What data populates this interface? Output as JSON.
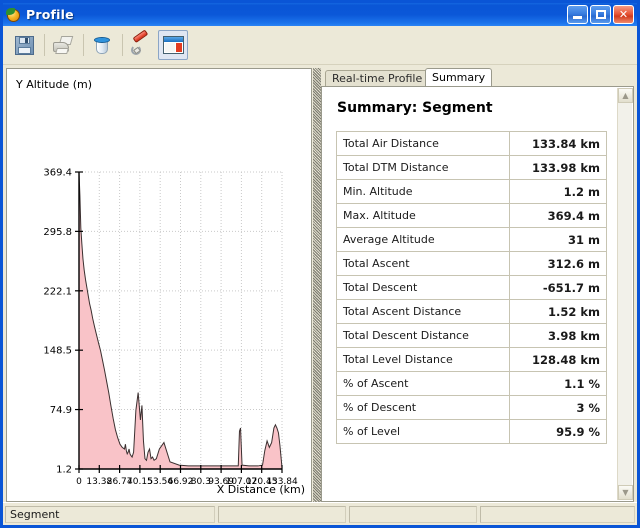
{
  "window": {
    "title": "Profile",
    "icon": "globe-icon",
    "buttons": {
      "minimize": "minimize-button",
      "maximize": "maximize-button",
      "close": "close-button"
    }
  },
  "toolbar": {
    "items": [
      {
        "name": "save-icon",
        "label": "Save",
        "enabled": true,
        "selected": false
      },
      {
        "name": "print-icon",
        "label": "Print",
        "enabled": false,
        "selected": false
      },
      {
        "name": "paint-bucket-icon",
        "label": "Fill Color",
        "enabled": true,
        "selected": false
      },
      {
        "name": "tools-icon",
        "label": "Tools",
        "enabled": true,
        "selected": false
      },
      {
        "name": "window-layout-icon",
        "label": "Show Summary Panel",
        "enabled": true,
        "selected": true
      }
    ]
  },
  "chart_panel": {
    "y_axis_title": "Y Altitude (m)",
    "x_axis_title": "X Distance (km)"
  },
  "chart_data": {
    "type": "area",
    "title": "",
    "xlabel": "X Distance (km)",
    "ylabel": "Y Altitude (m)",
    "xlim": [
      0,
      133.84
    ],
    "ylim": [
      1.2,
      369.4
    ],
    "grid": true,
    "legend": "none",
    "series_color": "#f9c3c8",
    "line_color": "#3a2f2f",
    "xticks": [
      0,
      13.38,
      26.77,
      40.15,
      53.54,
      66.92,
      80.3,
      93.69,
      107.07,
      120.45,
      133.84
    ],
    "yticks": [
      1.2,
      74.9,
      148.5,
      222.1,
      295.8,
      369.4
    ],
    "x": [
      0.0,
      0.6,
      1.2,
      1.9,
      2.6,
      3.4,
      4.3,
      5.2,
      6.1,
      7.0,
      8.0,
      9.0,
      10.2,
      11.5,
      12.8,
      14.2,
      15.5,
      16.8,
      18.2,
      19.6,
      21.0,
      22.5,
      24.0,
      25.5,
      27.0,
      28.5,
      30.0,
      30.6,
      31.2,
      31.8,
      32.4,
      33.0,
      33.6,
      34.2,
      35.0,
      36.0,
      37.5,
      39.0,
      40.5,
      41.5,
      42.5,
      43.5,
      44.5,
      45.5,
      46.5,
      47.5,
      48.5,
      49.5,
      51.0,
      53.0,
      56.0,
      60.0,
      66.0,
      72.0,
      78.0,
      84.0,
      90.0,
      96.0,
      102.0,
      105.0,
      105.8,
      106.5,
      107.5,
      112.0,
      118.0,
      121.0,
      122.5,
      124.0,
      125.5,
      127.0,
      128.5,
      129.5,
      130.5,
      131.5,
      132.5,
      133.84
    ],
    "y": [
      369.4,
      340.0,
      300.0,
      280.0,
      262.0,
      248.0,
      236.0,
      226.0,
      216.0,
      206.0,
      198.0,
      188.0,
      178.0,
      168.0,
      158.0,
      148.0,
      136.0,
      124.0,
      110.0,
      96.0,
      80.0,
      64.0,
      50.0,
      40.0,
      32.0,
      28.0,
      26.0,
      32.0,
      24.0,
      20.0,
      22.0,
      26.0,
      20.0,
      18.0,
      16.0,
      22.0,
      74.0,
      96.0,
      62.0,
      80.0,
      36.0,
      14.0,
      12.0,
      22.0,
      26.0,
      14.0,
      16.0,
      12.0,
      14.0,
      26.0,
      34.0,
      10.0,
      6.0,
      5.0,
      5.0,
      5.0,
      5.0,
      5.0,
      5.0,
      5.0,
      48.0,
      52.0,
      6.0,
      5.0,
      5.0,
      6.0,
      24.0,
      36.0,
      28.0,
      34.0,
      52.0,
      56.0,
      52.0,
      46.0,
      30.0,
      3.0
    ]
  },
  "summary_panel": {
    "tabs": [
      {
        "label": "Real-time Profile",
        "active": false
      },
      {
        "label": "Summary",
        "active": true
      }
    ],
    "heading": "Summary: Segment",
    "rows": [
      {
        "key": "Total Air Distance",
        "value": "133.84 km"
      },
      {
        "key": "Total DTM Distance",
        "value": "133.98 km"
      },
      {
        "key": "Min. Altitude",
        "value": "1.2 m"
      },
      {
        "key": "Max. Altitude",
        "value": "369.4 m"
      },
      {
        "key": "Average Altitude",
        "value": "31 m"
      },
      {
        "key": "Total Ascent",
        "value": "312.6 m"
      },
      {
        "key": "Total Descent",
        "value": "-651.7 m"
      },
      {
        "key": "Total Ascent Distance",
        "value": "1.52 km"
      },
      {
        "key": "Total Descent Distance",
        "value": "3.98 km"
      },
      {
        "key": "Total Level Distance",
        "value": "128.48 km"
      },
      {
        "key": "% of Ascent",
        "value": "1.1 %"
      },
      {
        "key": "% of Descent",
        "value": "3 %"
      },
      {
        "key": "% of Level",
        "value": "95.9 %"
      }
    ],
    "scroll": {
      "up_arrow": "scroll-up-icon",
      "down_arrow": "scroll-down-icon",
      "left_arrow": "scroll-left-icon",
      "right_arrow": "scroll-right-icon"
    }
  },
  "statusbar": {
    "cells": [
      "Segment",
      "",
      "",
      ""
    ]
  },
  "colors": {
    "titlebar": "#0a56d6",
    "window_border": "#0a55d6",
    "chrome": "#ece9d8",
    "area_fill": "#f9c3c8",
    "area_line": "#3a2f2f"
  }
}
